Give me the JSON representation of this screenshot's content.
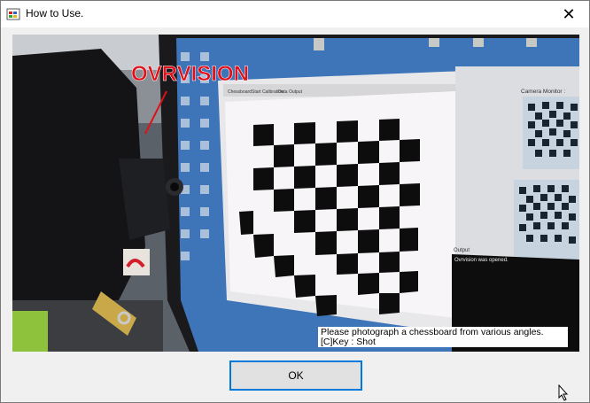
{
  "window": {
    "title": "How to Use.",
    "close_glyph": "✕",
    "app_icon": "application-icon"
  },
  "photo": {
    "brand_label": "OVRVISION",
    "screen_tabs": [
      "Chessboard",
      "Start Calibration",
      "Data Output"
    ],
    "camera_monitor_label": "Camera Monitor :",
    "output_label": "Output",
    "output_text": "Ovrvision was opened.",
    "caption_line1": "Please photograph a chessboard from various angles.",
    "caption_line2": "[C]Key : Shot",
    "brand_color": "#e0101a"
  },
  "footer": {
    "ok_label": "OK"
  }
}
